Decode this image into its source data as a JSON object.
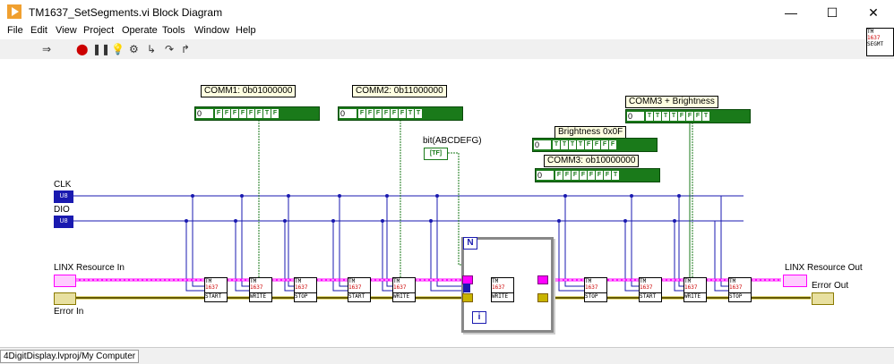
{
  "window": {
    "title": "TM1637_SetSegments.vi Block Diagram",
    "minimize": "—",
    "maximize": "☐",
    "close": "✕"
  },
  "menu": [
    "File",
    "Edit",
    "View",
    "Project",
    "Operate",
    "Tools",
    "Window",
    "Help"
  ],
  "toolbar": {
    "icons": [
      "run-arrow-icon",
      "abort-icon",
      "pause-icon",
      "highlight-execution-icon",
      "retain-wire-values-icon",
      "step-into-icon",
      "step-over-icon",
      "step-out-icon"
    ]
  },
  "vi_icon": {
    "line1": "TM",
    "line2": "1637",
    "line3": "SEGMT"
  },
  "diagram": {
    "comm1_label": "COMM1: 0b01000000",
    "comm1_num": "0",
    "comm1_bits": [
      "F",
      "F",
      "F",
      "F",
      "F",
      "F",
      "T",
      "F"
    ],
    "comm2_label": "COMM2: 0b11000000",
    "comm2_num": "0",
    "comm2_bits": [
      "F",
      "F",
      "F",
      "F",
      "F",
      "F",
      "T",
      "T"
    ],
    "comm3b_label": "COMM3 + Brightness",
    "comm3b_num": "0",
    "comm3b_bits": [
      "T",
      "T",
      "T",
      "T",
      "F",
      "F",
      "F",
      "T"
    ],
    "brightness_label": "Brightness 0x0F",
    "brightness_num": "0",
    "brightness_bits": [
      "T",
      "T",
      "T",
      "T",
      "F",
      "F",
      "F",
      "F"
    ],
    "comm3_label": "COMM3: ob10000000",
    "comm3_num": "0",
    "comm3_bits": [
      "F",
      "F",
      "F",
      "F",
      "F",
      "F",
      "F",
      "T"
    ],
    "bit_label": "bit(ABCDEFG)",
    "bit_terminal": "[TF]",
    "clk_label": "CLK",
    "clk_terminal": "U8",
    "dio_label": "DIO",
    "dio_terminal": "U8",
    "linx_in_label": "LINX Resource In",
    "linx_out_label": "LINX Resource Out",
    "error_in_label": "Error In",
    "error_out_label": "Error Out",
    "loop_n": "N",
    "loop_i": "i",
    "subvis": [
      {
        "top": "TM",
        "mid": "1637",
        "bottom": "START"
      },
      {
        "top": "TM",
        "mid": "1637",
        "bottom": "WRITE"
      },
      {
        "top": "TM",
        "mid": "1637",
        "bottom": "STOP"
      },
      {
        "top": "TM",
        "mid": "1637",
        "bottom": "START"
      },
      {
        "top": "TM",
        "mid": "1637",
        "bottom": "WRITE"
      },
      {
        "top": "TM",
        "mid": "1637",
        "bottom": "WRITE"
      },
      {
        "top": "TM",
        "mid": "1637",
        "bottom": "STOP"
      },
      {
        "top": "TM",
        "mid": "1637",
        "bottom": "START"
      },
      {
        "top": "TM",
        "mid": "1637",
        "bottom": "WRITE"
      },
      {
        "top": "TM",
        "mid": "1637",
        "bottom": "STOP"
      }
    ]
  },
  "status_bar": {
    "path": "4DigitDisplay.lvproj/My Computer"
  },
  "colors": {
    "u8_wire": "#1a1ab0",
    "linx_wire": "#ff00ff",
    "error_wire": "#c8b400",
    "bool_wire": "#1a7a1a"
  }
}
